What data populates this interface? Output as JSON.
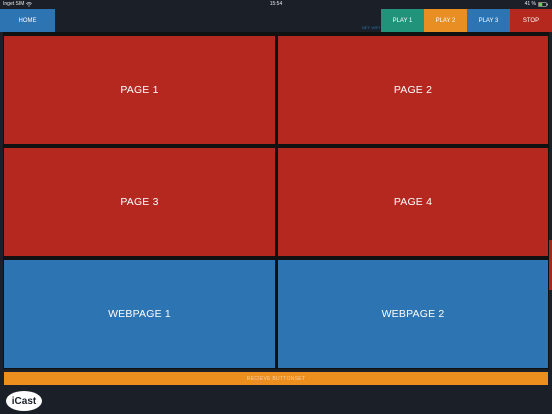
{
  "statusbar": {
    "carrier": "Inget SIM",
    "time": "15:54",
    "battery": "41 %"
  },
  "topbar": {
    "home_label": "HOME",
    "net_label": "NET: WIFI",
    "play1_label": "PLAY 1",
    "play2_label": "PLAY 2",
    "play3_label": "PLAY 3",
    "stop_label": "STOP",
    "colors": {
      "home": "#2d74b3",
      "play1": "#21937b",
      "play2": "#e98e22",
      "play3": "#2d74b3",
      "stop": "#b5281e"
    }
  },
  "tiles": [
    {
      "label": "PAGE 1",
      "color": "red"
    },
    {
      "label": "PAGE 2",
      "color": "red"
    },
    {
      "label": "PAGE 3",
      "color": "red"
    },
    {
      "label": "PAGE 4",
      "color": "red"
    },
    {
      "label": "WEBPAGE 1",
      "color": "blue"
    },
    {
      "label": "WEBPAGE 2",
      "color": "blue"
    }
  ],
  "receive_label": "RECIEVE BUTTONSET",
  "logo_text": "iCast",
  "icons": {
    "wifi": "wifi-icon",
    "battery": "battery-icon"
  }
}
